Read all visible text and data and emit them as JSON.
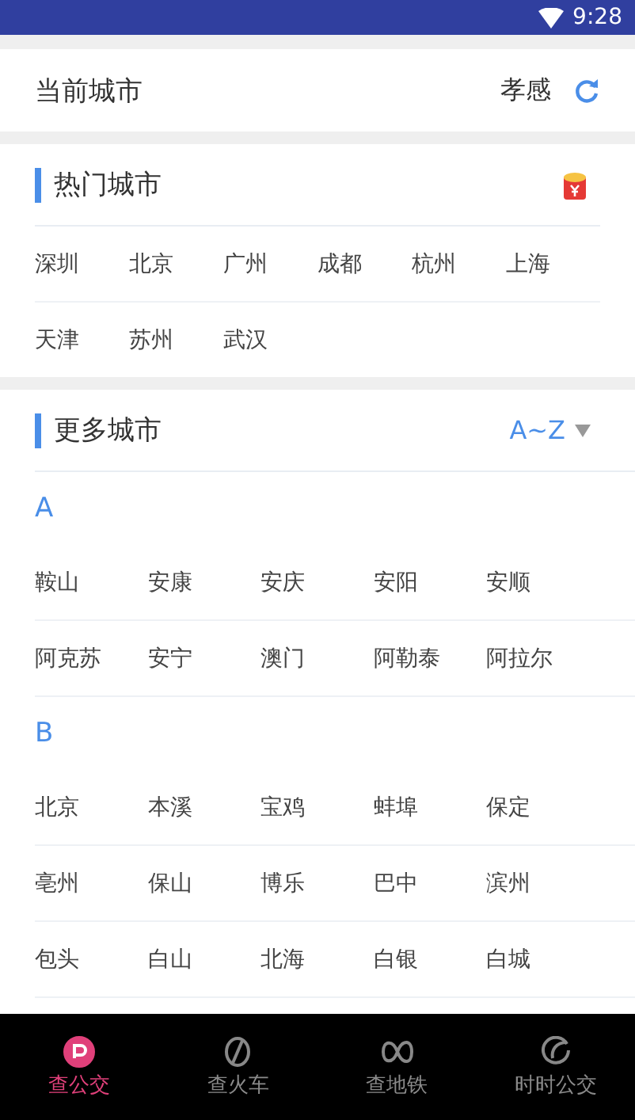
{
  "status_bar": {
    "time": "9:28"
  },
  "current_city": {
    "label": "当前城市",
    "city": "孝感"
  },
  "hot_cities": {
    "title": "热门城市",
    "rows": [
      [
        "深圳",
        "北京",
        "广州",
        "成都",
        "杭州",
        "上海"
      ],
      [
        "天津",
        "苏州",
        "武汉"
      ]
    ]
  },
  "more_cities": {
    "title": "更多城市",
    "sort": "A~Z",
    "groups": [
      {
        "letter": "A",
        "rows": [
          [
            "鞍山",
            "安康",
            "安庆",
            "安阳",
            "安顺"
          ],
          [
            "阿克苏",
            "安宁",
            "澳门",
            "阿勒泰",
            "阿拉尔"
          ]
        ]
      },
      {
        "letter": "B",
        "rows": [
          [
            "北京",
            "本溪",
            "宝鸡",
            "蚌埠",
            "保定"
          ],
          [
            "亳州",
            "保山",
            "博乐",
            "巴中",
            "滨州"
          ],
          [
            "包头",
            "白山",
            "北海",
            "白银",
            "白城"
          ]
        ]
      }
    ]
  },
  "tabs": [
    {
      "label": "查公交",
      "selected": true
    },
    {
      "label": "查火车",
      "selected": false
    },
    {
      "label": "查地铁",
      "selected": false
    },
    {
      "label": "时时公交",
      "selected": false
    }
  ]
}
